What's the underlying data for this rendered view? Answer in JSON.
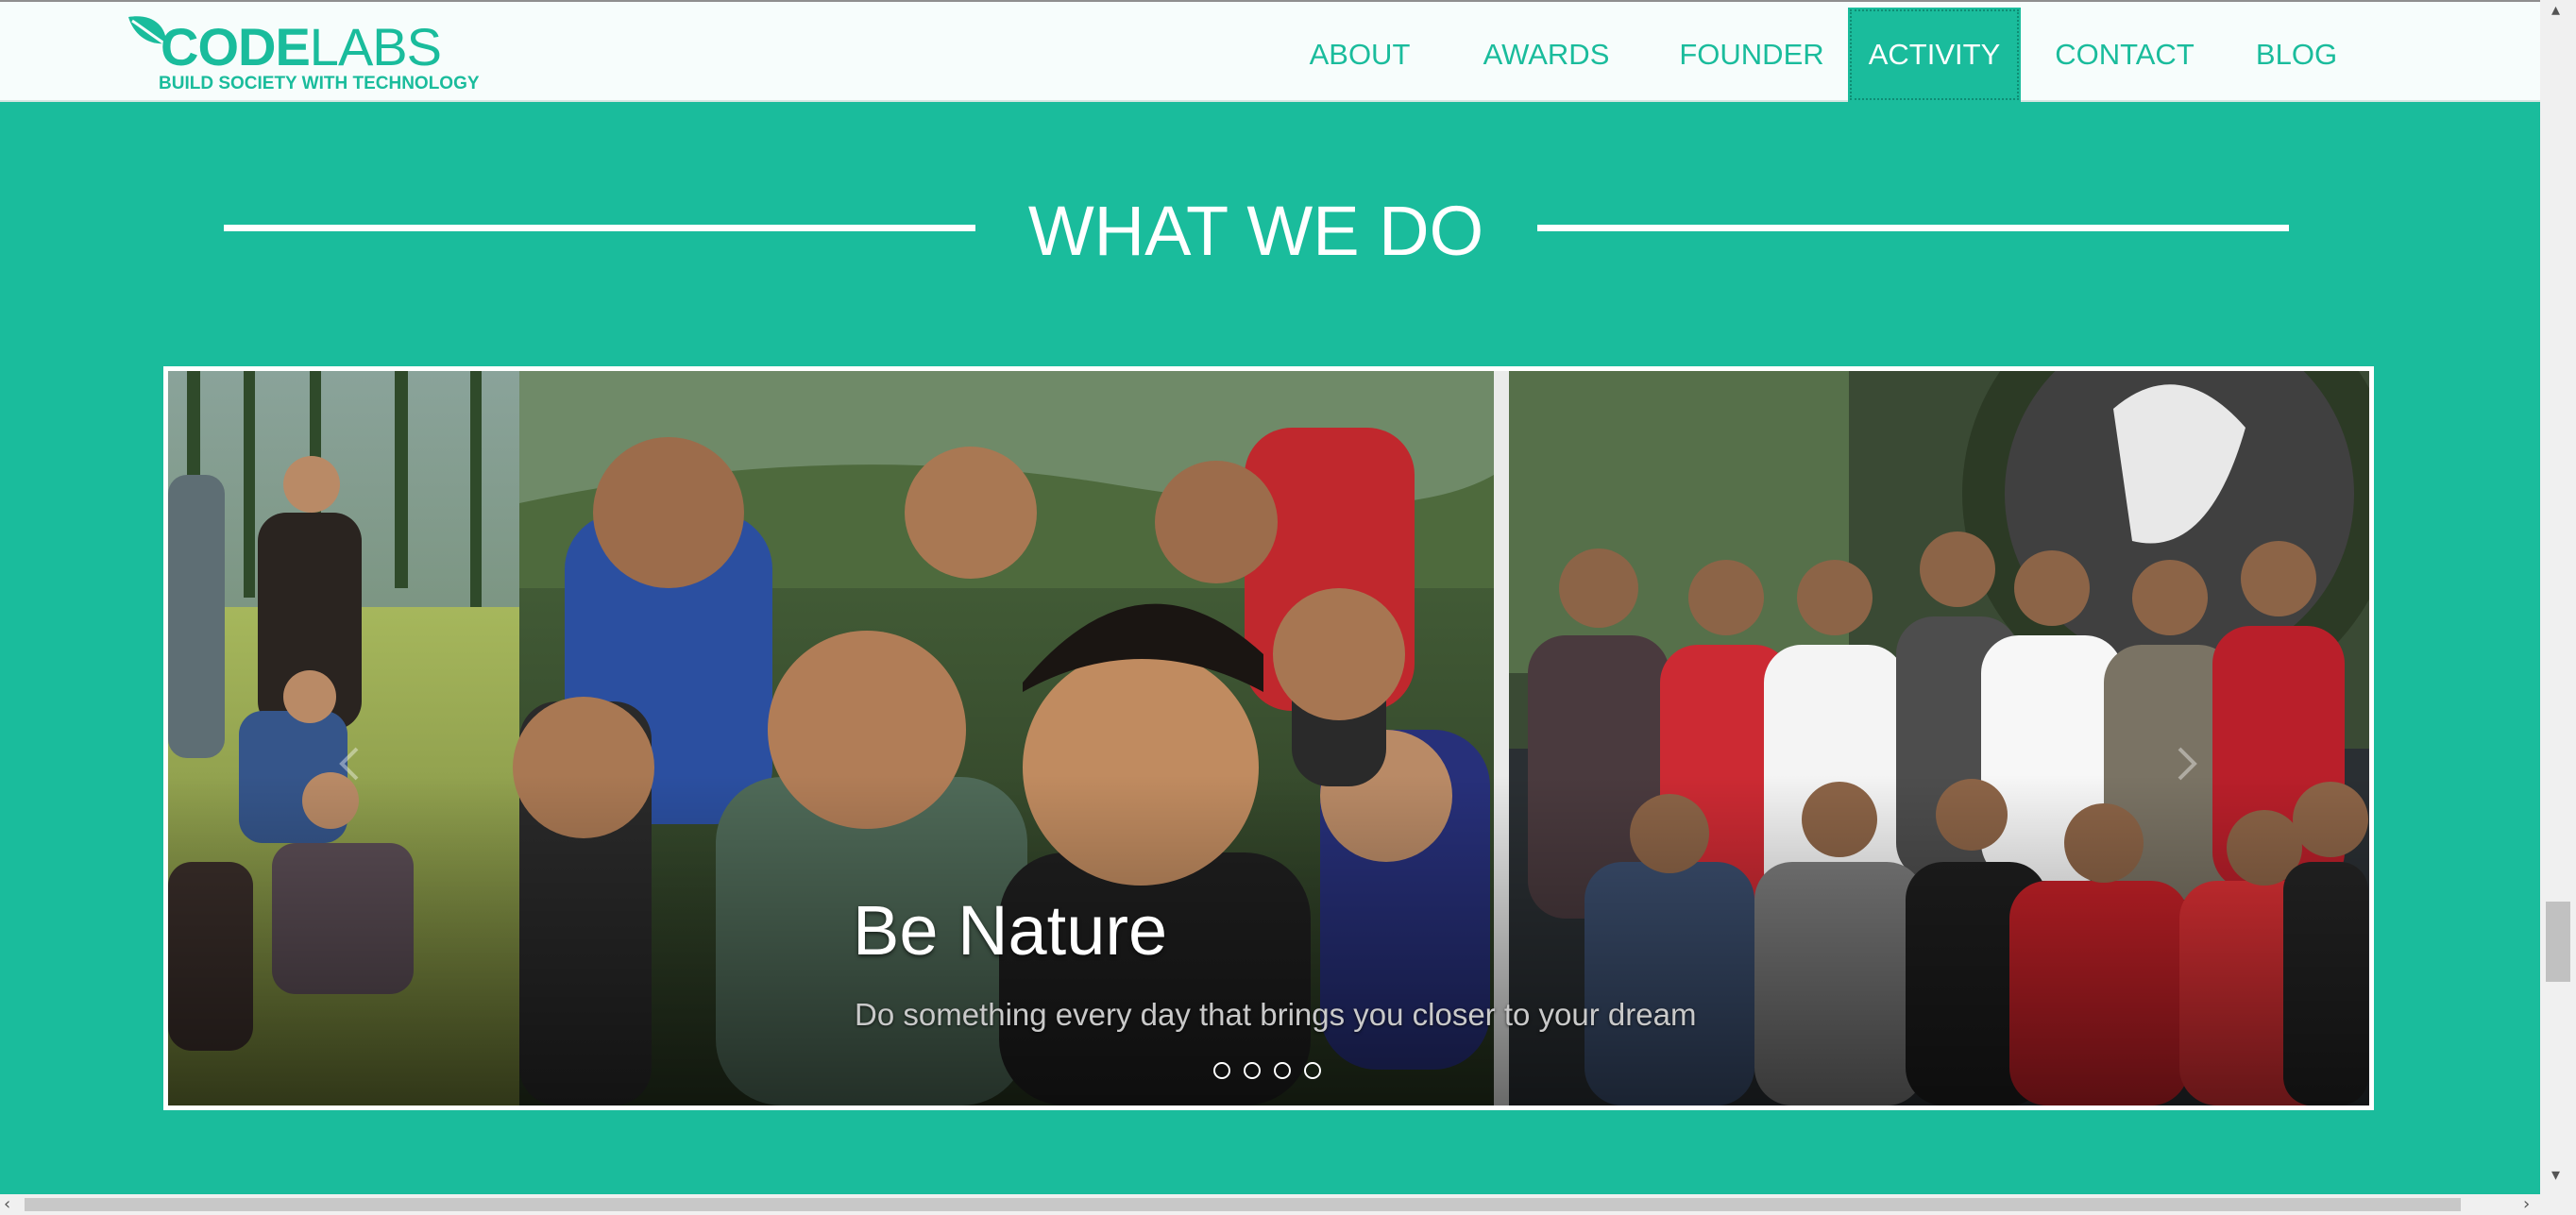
{
  "header": {
    "logo": {
      "main_bold": "CODE",
      "main_light": "LABS",
      "tagline": "BUILD SOCIETY WITH TECHNOLOGY"
    },
    "nav": [
      {
        "label": "ABOUT",
        "active": false
      },
      {
        "label": "AWARDS",
        "active": false
      },
      {
        "label": "FOUNDER",
        "active": false
      },
      {
        "label": "ACTIVITY",
        "active": true
      },
      {
        "label": "CONTACT",
        "active": false
      },
      {
        "label": "BLOG",
        "active": false
      }
    ]
  },
  "section": {
    "title": "WHAT WE DO"
  },
  "carousel": {
    "caption_title": "Be Nature",
    "caption_text": "Do something every day that brings you closer to your dream",
    "slide_count": 4,
    "active_slide": 1
  },
  "colors": {
    "brand": "#1abc9c",
    "nav_bg": "#f7fdfc",
    "text_light": "#ffffff"
  },
  "icons": {
    "logo_leaf": "leaf-icon",
    "prev": "chevron-left-icon",
    "next": "chevron-right-icon"
  }
}
